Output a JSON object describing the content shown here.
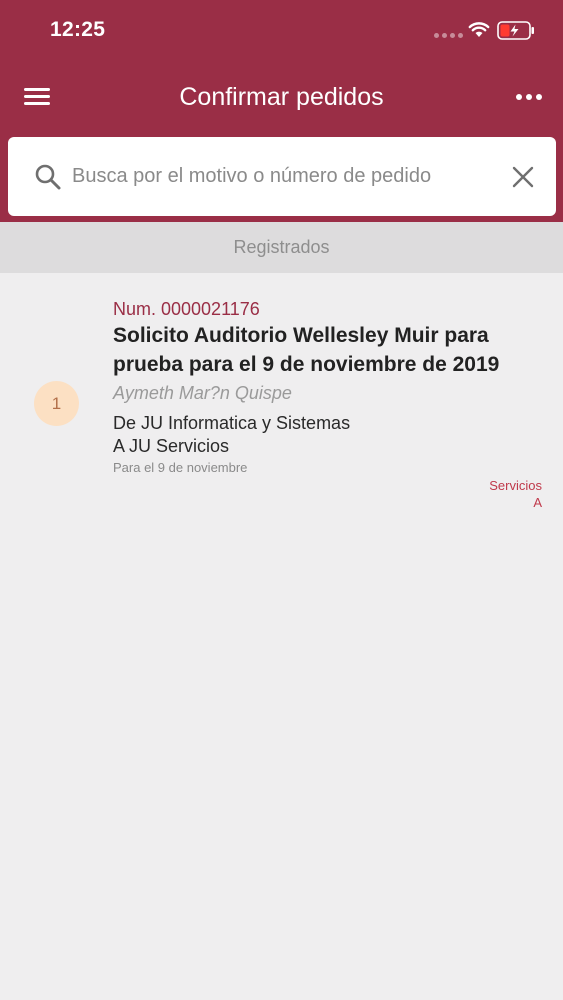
{
  "status_bar": {
    "time": "12:25"
  },
  "nav": {
    "title": "Confirmar pedidos"
  },
  "search": {
    "placeholder": "Busca por el motivo o número de pedido",
    "value": ""
  },
  "section": {
    "label": "Registrados"
  },
  "orders": [
    {
      "badge": "1",
      "number": "Num. 0000021176",
      "title": "Solicito Auditorio Wellesley Muir para prueba para el 9 de noviembre de 2019",
      "requester": "Aymeth  Mar?n Quispe",
      "from": "De JU Informatica y Sistemas",
      "to": "A JU Servicios",
      "date": "Para el 9 de noviembre",
      "category_line1": "Servicios",
      "category_line2": "A"
    }
  ],
  "icons": {
    "menu": "menu-icon",
    "more": "more-icon",
    "search": "search-icon",
    "clear": "close-icon",
    "wifi": "wifi-icon",
    "battery": "battery-icon"
  },
  "colors": {
    "primary": "#9a2e46",
    "badge_bg": "#fce0c3",
    "category_text": "#c0394b",
    "section_bg": "#dddcdd",
    "page_bg": "#efeeef"
  }
}
